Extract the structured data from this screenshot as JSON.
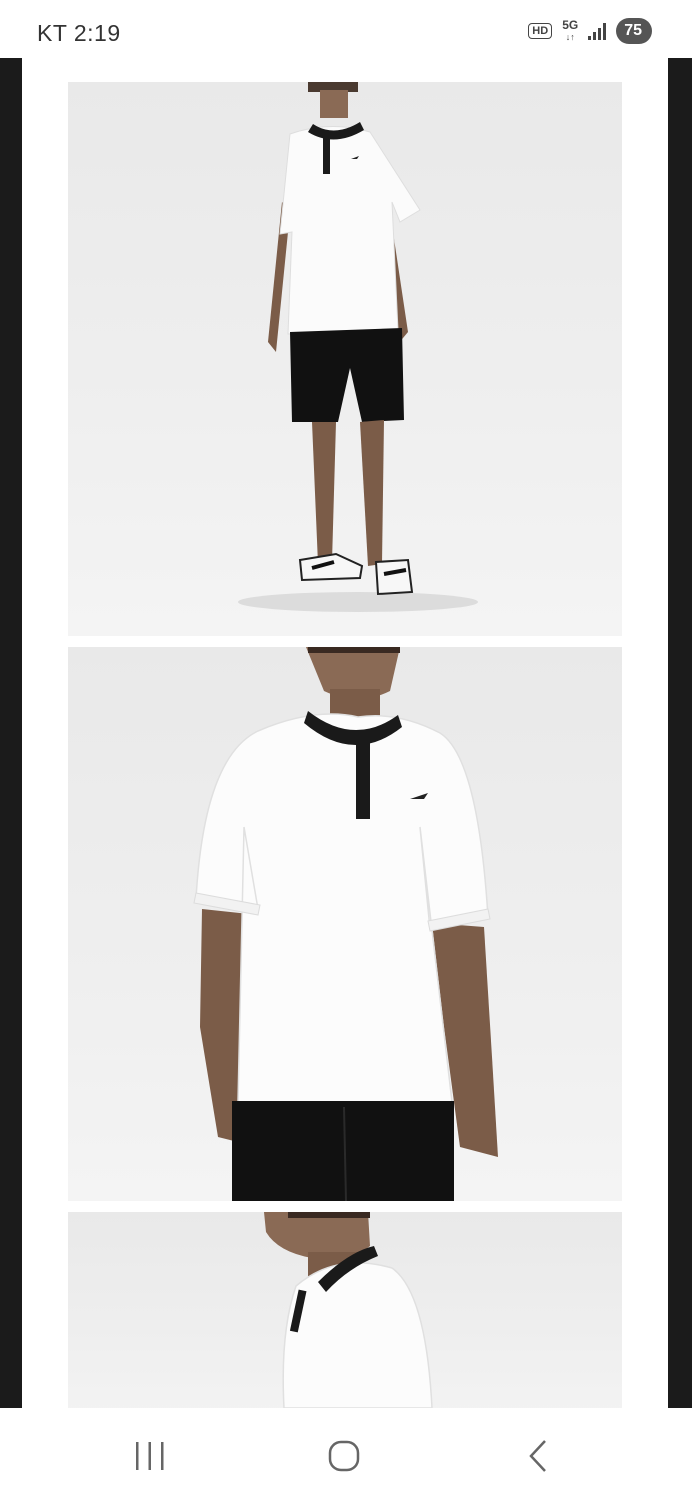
{
  "status_bar": {
    "carrier": "KT 2:19",
    "hd": "HD",
    "network_top": "5G",
    "network_bottom": "↓↑",
    "battery": "75"
  },
  "gallery": {
    "images": [
      {
        "icon": "full-body-model-photo"
      },
      {
        "icon": "upper-body-model-photo"
      },
      {
        "icon": "side-profile-model-photo"
      }
    ]
  },
  "nav_bar": {
    "recent": "recent-apps-icon",
    "home": "home-icon",
    "back": "back-icon"
  },
  "colors": {
    "background": "#ffffff",
    "viewer_frame": "#1b1b1b",
    "photo_bg": "#ececec"
  }
}
